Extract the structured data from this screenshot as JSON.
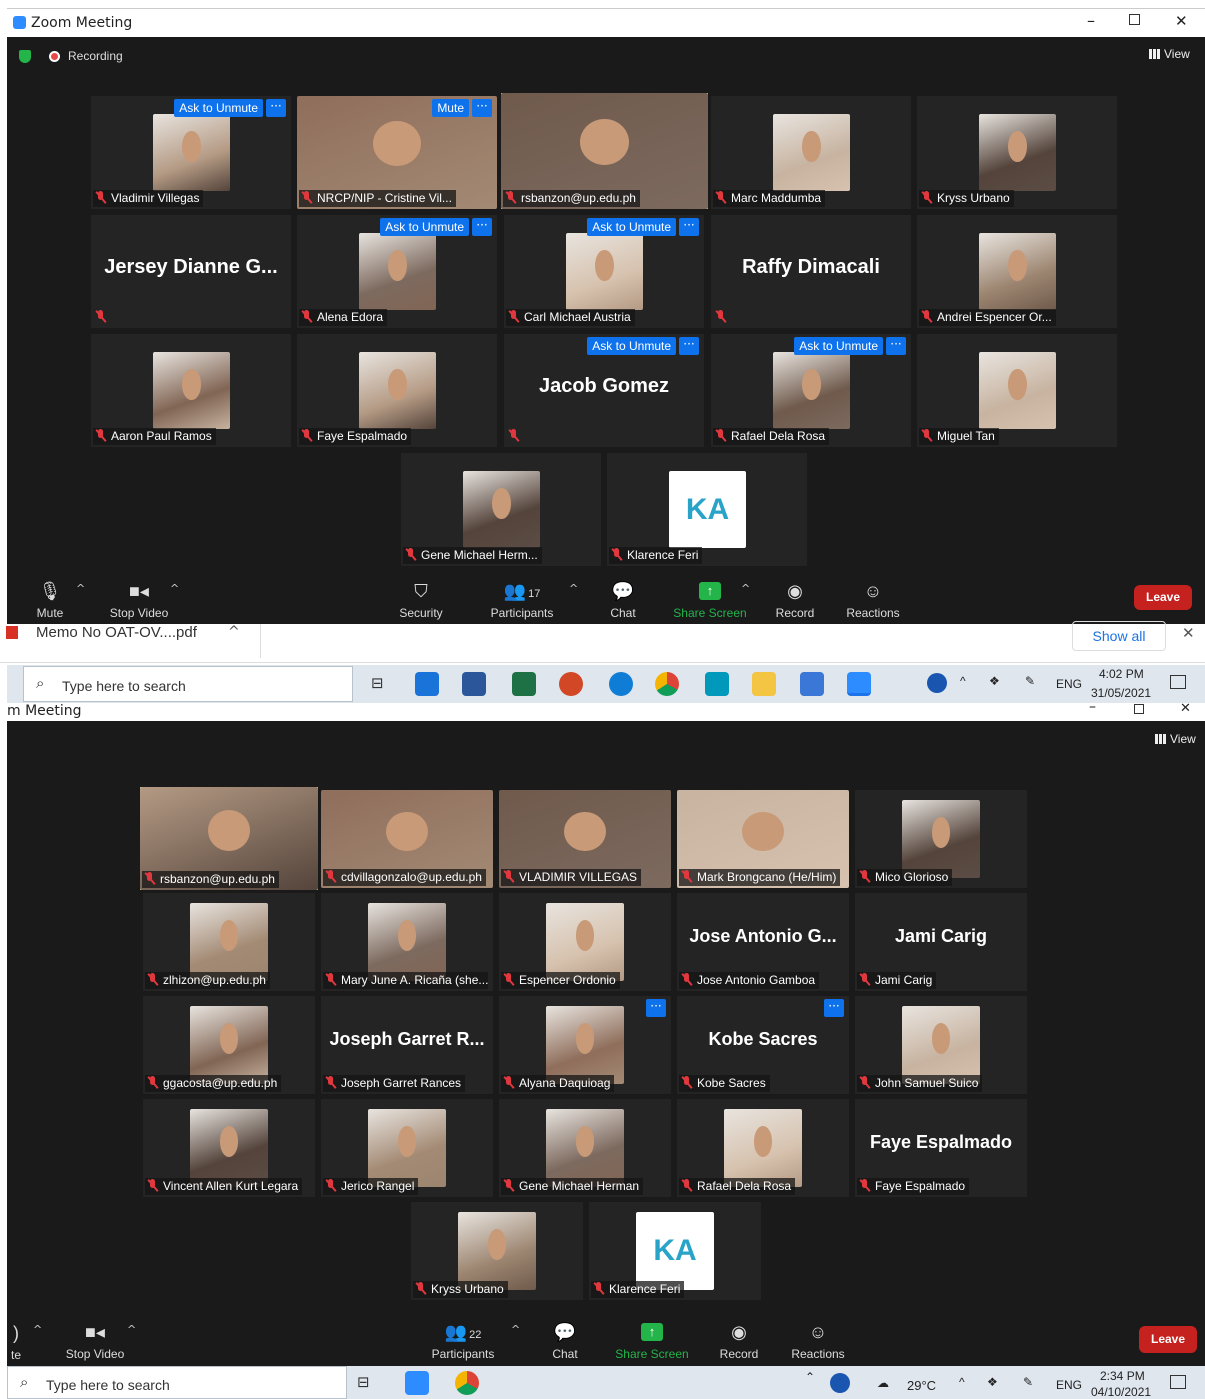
{
  "top": {
    "window_title": "Zoom Meeting",
    "recording_label": "Recording",
    "view_label": "View",
    "tiles": [
      {
        "name": "Vladimir Villegas",
        "badge": "Ask to Unmute",
        "dots": "···"
      },
      {
        "name": "NRCP/NIP - Cristine Vil...",
        "badge": "Mute",
        "dots": "···"
      },
      {
        "name": "rsbanzon@up.edu.ph"
      },
      {
        "name": "Marc Maddumba"
      },
      {
        "name": "Kryss Urbano"
      },
      {
        "name": "",
        "big": "Jersey  Dianne  G..."
      },
      {
        "name": "Alena Edora",
        "badge": "Ask to Unmute",
        "dots": "···"
      },
      {
        "name": "Carl Michael Austria",
        "badge": "Ask to Unmute",
        "dots": "···"
      },
      {
        "name": "",
        "big": "Raffy Dimacali"
      },
      {
        "name": "Andrei Espencer Or..."
      },
      {
        "name": "Aaron Paul Ramos"
      },
      {
        "name": "Faye Espalmado"
      },
      {
        "name": "",
        "big": "Jacob Gomez",
        "badge": "Ask to Unmute",
        "dots": "···"
      },
      {
        "name": "Rafael Dela Rosa",
        "badge": "Ask to Unmute",
        "dots": "···"
      },
      {
        "name": "Miguel Tan"
      },
      {
        "name": "Gene Michael Herm..."
      },
      {
        "name": "Klarence Feri",
        "logo": "KA"
      }
    ],
    "toolbar": {
      "mute": "Mute",
      "stop_video": "Stop Video",
      "security": "Security",
      "participants": "Participants",
      "participants_count": "17",
      "chat": "Chat",
      "share_screen": "Share Screen",
      "record": "Record",
      "reactions": "Reactions",
      "leave": "Leave"
    },
    "download_bar": {
      "file": "Memo No OAT-OV....pdf",
      "show_all": "Show all",
      "close": "✕"
    },
    "taskbar": {
      "search_placeholder": "Type here to search",
      "lang": "ENG",
      "time": "4:02 PM",
      "date": "31/05/2021"
    }
  },
  "bottom": {
    "window_title": "m Meeting",
    "view_label": "View",
    "tiles": [
      {
        "name": "rsbanzon@up.edu.ph"
      },
      {
        "name": "cdvillagonzalo@up.edu.ph"
      },
      {
        "name": "VLADIMIR VILLEGAS"
      },
      {
        "name": "Mark Brongcano (He/Him)"
      },
      {
        "name": "Mico Glorioso"
      },
      {
        "name": "zlhizon@up.edu.ph"
      },
      {
        "name": "Mary June A. Ricaña (she..."
      },
      {
        "name": "Espencer Ordonio"
      },
      {
        "name": "Jose Antonio Gamboa",
        "big": "Jose  Antonio  G..."
      },
      {
        "name": "Jami Carig",
        "big": "Jami  Carig"
      },
      {
        "name": "ggacosta@up.edu.ph"
      },
      {
        "name": "Joseph Garret Rances",
        "big": "Joseph  Garret  R..."
      },
      {
        "name": "Alyana Daquioag",
        "dots": "···"
      },
      {
        "name": "Kobe Sacres",
        "big": "Kobe Sacres",
        "dots": "···"
      },
      {
        "name": "John Samuel Suico"
      },
      {
        "name": "Vincent Allen Kurt Legara"
      },
      {
        "name": "Jerico Rangel"
      },
      {
        "name": "Gene Michael Herman"
      },
      {
        "name": "Rafael Dela Rosa"
      },
      {
        "name": "Faye Espalmado",
        "big": "Faye Espalmado"
      },
      {
        "name": "Kryss Urbano"
      },
      {
        "name": "Klarence Feri",
        "logo": "KA"
      }
    ],
    "toolbar": {
      "mute": "te",
      "stop_video": "Stop Video",
      "participants": "Participants",
      "participants_count": "22",
      "chat": "Chat",
      "share_screen": "Share Screen",
      "record": "Record",
      "reactions": "Reactions",
      "leave": "Leave"
    },
    "taskbar": {
      "search_placeholder": "Type here to search",
      "weather": "29°C",
      "lang": "ENG",
      "time": "2:34 PM",
      "date": "04/10/2021"
    }
  },
  "colors": {
    "zoom_bg": "#1a1a1a",
    "tile": "#242424",
    "accent": "#0e72ed",
    "active": "#c8df7a",
    "leave": "#c4211f",
    "share": "#23b44a"
  }
}
